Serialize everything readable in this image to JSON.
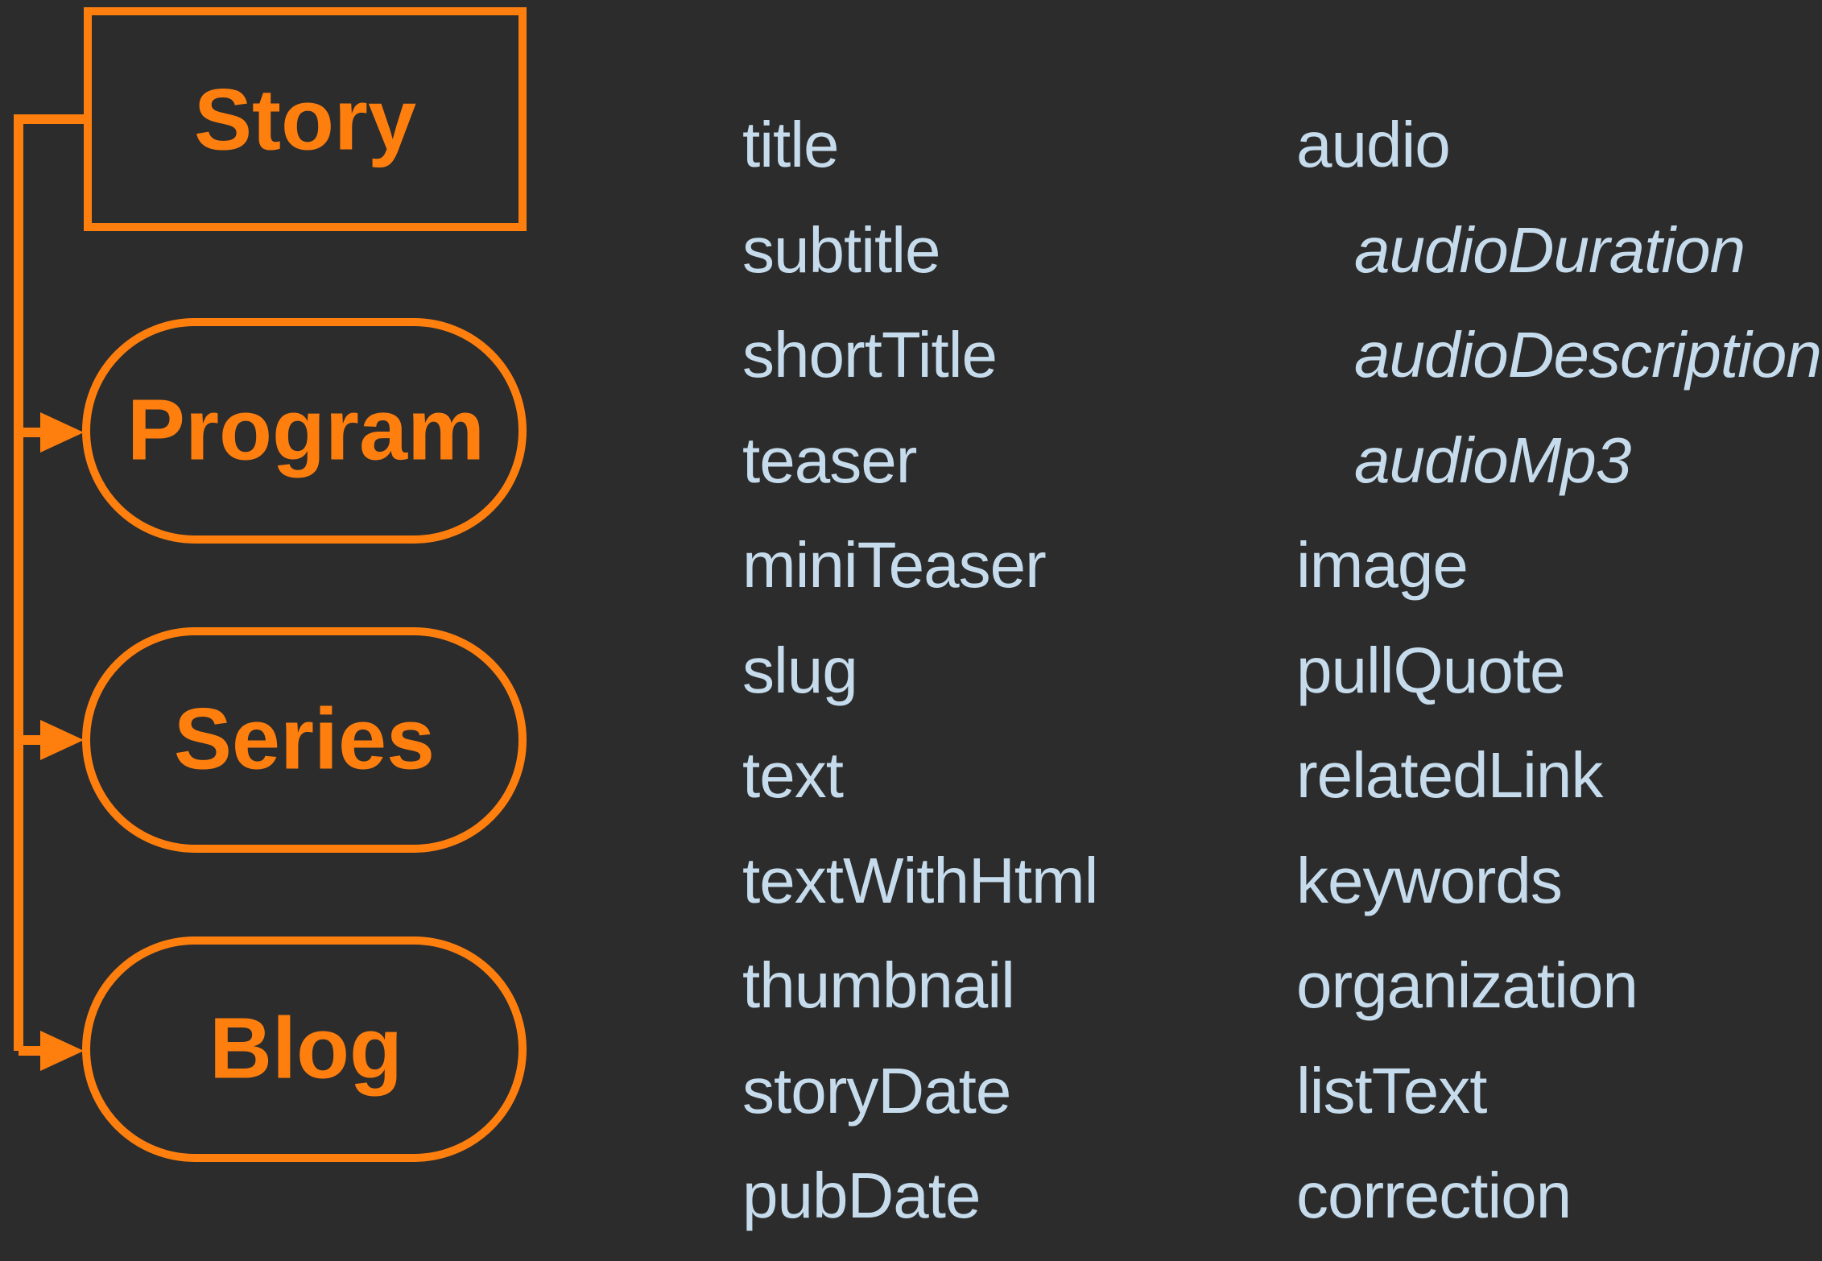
{
  "colors": {
    "background": "#2c2c2c",
    "accent": "#ff7f0e",
    "field_text": "#c6dcec"
  },
  "nodes": {
    "story": "Story",
    "program": "Program",
    "series": "Series",
    "blog": "Blog"
  },
  "fields_left": [
    {
      "label": "title"
    },
    {
      "label": "subtitle"
    },
    {
      "label": "shortTitle"
    },
    {
      "label": "teaser"
    },
    {
      "label": "miniTeaser"
    },
    {
      "label": "slug"
    },
    {
      "label": "text"
    },
    {
      "label": "textWithHtml"
    },
    {
      "label": "thumbnail"
    },
    {
      "label": "storyDate"
    },
    {
      "label": "pubDate"
    }
  ],
  "fields_right": [
    {
      "label": "audio"
    },
    {
      "label": "audioDuration",
      "sub": true
    },
    {
      "label": "audioDescription",
      "sub": true
    },
    {
      "label": "audioMp3",
      "sub": true
    },
    {
      "label": "image"
    },
    {
      "label": "pullQuote"
    },
    {
      "label": "relatedLink"
    },
    {
      "label": "keywords"
    },
    {
      "label": "organization"
    },
    {
      "label": "listText"
    },
    {
      "label": "correction"
    }
  ]
}
